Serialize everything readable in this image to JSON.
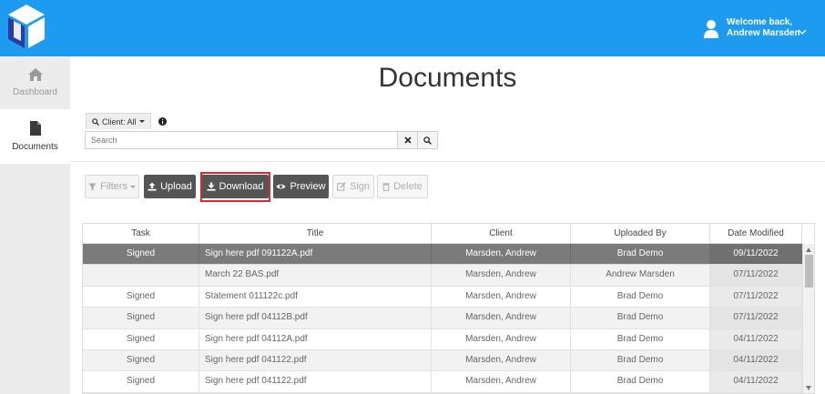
{
  "header": {
    "welcome_line": "Welcome back,",
    "user_name": "Andrew Marsden",
    "brand_color": "#1c9bf0",
    "icons": {
      "logo": "app-logo",
      "avatar": "user-icon",
      "menu": "chevron-down-icon"
    }
  },
  "sidebar": {
    "items": [
      {
        "label": "Dashboard",
        "icon": "home-icon"
      },
      {
        "label": "Documents",
        "icon": "file-icon"
      }
    ]
  },
  "page": {
    "title": "Documents"
  },
  "filter": {
    "client_label": "Client: All",
    "search_placeholder": "Search"
  },
  "toolbar": {
    "filters": "Filters",
    "upload": "Upload",
    "download": "Download",
    "preview": "Preview",
    "sign": "Sign",
    "delete": "Delete",
    "highlight_color": "#e0262b"
  },
  "table": {
    "columns": [
      "Task",
      "Title",
      "Client",
      "Uploaded By",
      "Date Modified"
    ],
    "rows": [
      {
        "task": "Signed",
        "title": "Sign here pdf 091122A.pdf",
        "client": "Marsden, Andrew",
        "uploaded_by": "Brad Demo",
        "date": "09/11/2022",
        "selected": true
      },
      {
        "task": "",
        "title": "March 22 BAS.pdf",
        "client": "Marsden, Andrew",
        "uploaded_by": "Andrew Marsden",
        "date": "07/11/2022"
      },
      {
        "task": "Signed",
        "title": "Statement 011122c.pdf",
        "client": "Marsden, Andrew",
        "uploaded_by": "Brad Demo",
        "date": "07/11/2022"
      },
      {
        "task": "Signed",
        "title": "Sign here pdf 04112B.pdf",
        "client": "Marsden, Andrew",
        "uploaded_by": "Brad Demo",
        "date": "07/11/2022"
      },
      {
        "task": "Signed",
        "title": "Sign here pdf 04112A.pdf",
        "client": "Marsden, Andrew",
        "uploaded_by": "Brad Demo",
        "date": "04/11/2022"
      },
      {
        "task": "Signed",
        "title": "Sign here pdf 041122.pdf",
        "client": "Marsden, Andrew",
        "uploaded_by": "Brad Demo",
        "date": "04/11/2022"
      },
      {
        "task": "Signed",
        "title": "Sign here pdf 041122.pdf",
        "client": "Marsden, Andrew",
        "uploaded_by": "Brad Demo",
        "date": "04/11/2022"
      }
    ]
  }
}
